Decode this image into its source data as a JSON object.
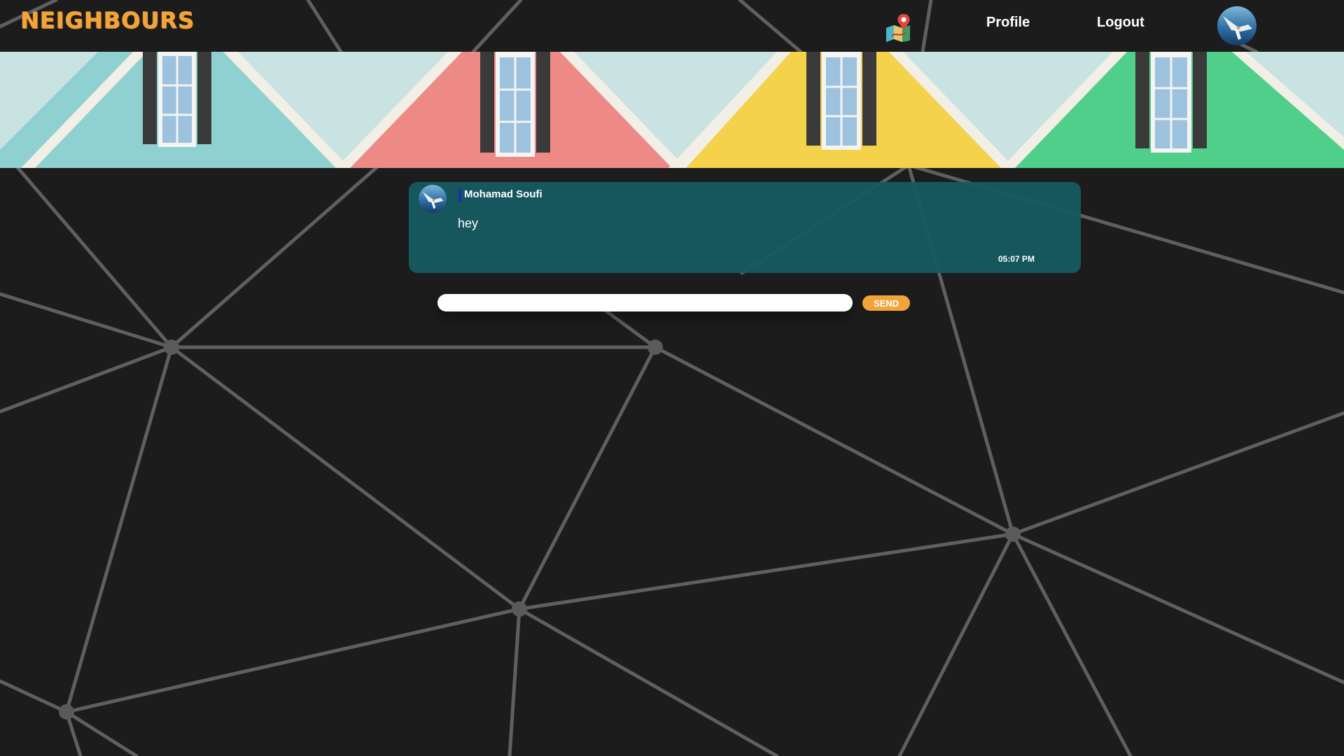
{
  "app": {
    "logo_text": "NEIGHBOURS",
    "accent_color": "#f2a43a"
  },
  "nav": {
    "map_icon": "map-pin-icon",
    "profile_label": "Profile",
    "logout_label": "Logout",
    "avatar_icon": "user-avatar"
  },
  "banner": {
    "description_colors": [
      "#8fd1d0",
      "#ee8a86",
      "#f4d24c",
      "#4fcf8a"
    ]
  },
  "chat": {
    "messages": [
      {
        "sender": "Mohamad Soufi",
        "text": "hey",
        "time": "05:07 PM"
      }
    ],
    "message_bg_color": "#165860"
  },
  "composer": {
    "value": "",
    "placeholder": "",
    "send_label": "SEND"
  }
}
